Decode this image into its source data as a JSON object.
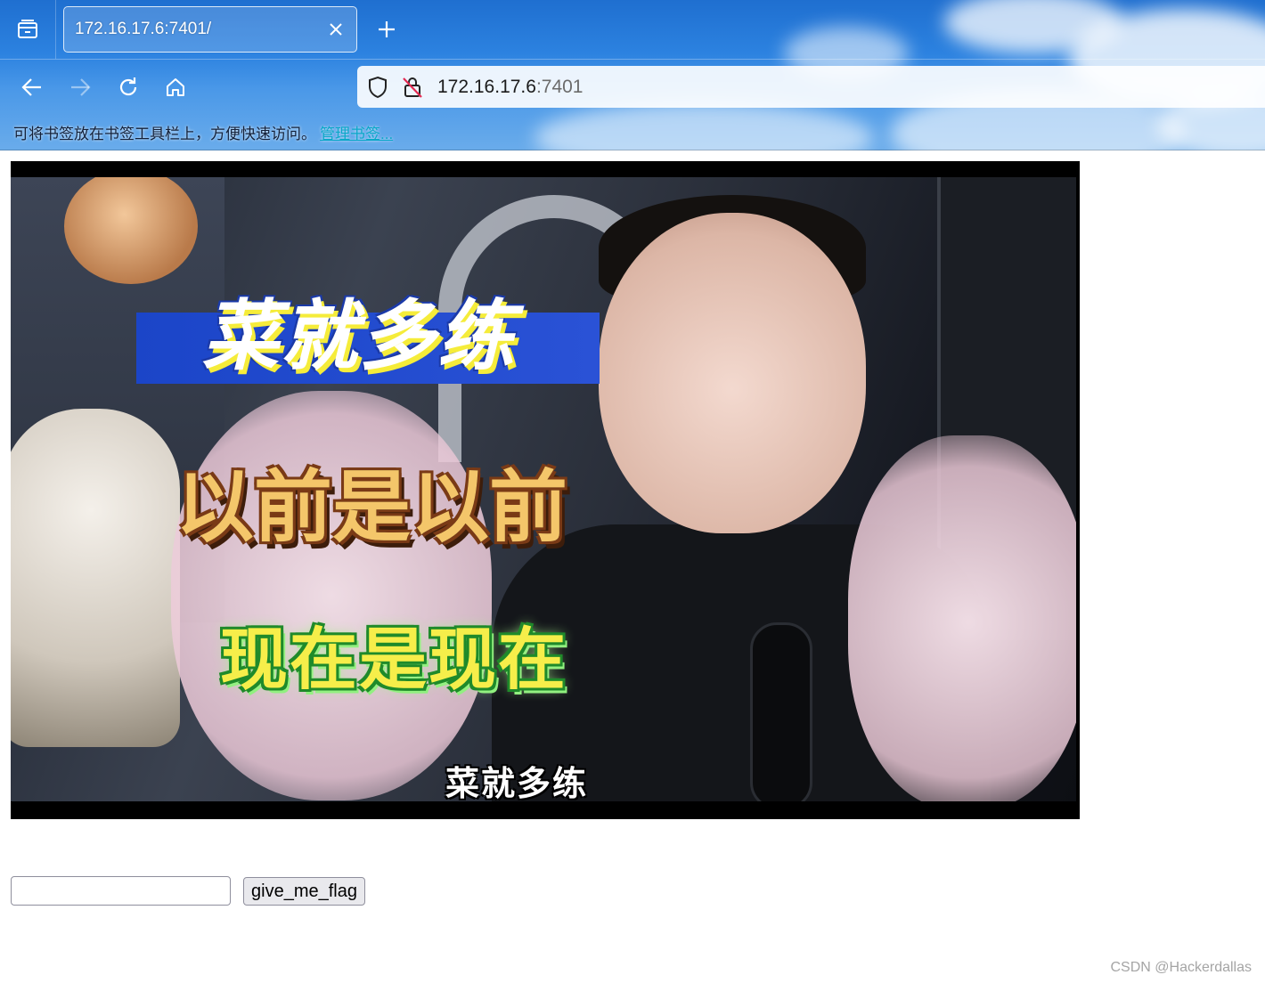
{
  "browser": {
    "tab": {
      "title": "172.16.17.6:7401/"
    },
    "urlbar": {
      "host": "172.16.17.6",
      "port": ":7401"
    },
    "bookmarks_bar": {
      "message": "可将书签放在书签工具栏上，方便快速访问。",
      "manage_link": "管理书签..."
    }
  },
  "video": {
    "caption_top": "菜就多练",
    "caption_middle": "以前是以前",
    "caption_bottom": "现在是现在",
    "subtitle": "菜就多练"
  },
  "form": {
    "input_value": "",
    "submit_label": "give_me_flag"
  },
  "watermark": "CSDN @Hackerdallas"
}
